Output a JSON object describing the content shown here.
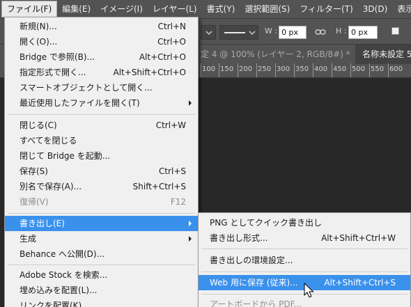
{
  "menubar": {
    "items": [
      {
        "label": "ファイル(F)",
        "active": true
      },
      {
        "label": "編集(E)"
      },
      {
        "label": "イメージ(I)"
      },
      {
        "label": "レイヤー(L)"
      },
      {
        "label": "書式(Y)"
      },
      {
        "label": "選択範囲(S)"
      },
      {
        "label": "フィルター(T)"
      },
      {
        "label": "3D(D)"
      },
      {
        "label": "表示(V"
      }
    ]
  },
  "options_bar": {
    "w_label": "W :",
    "w_value": "0 px",
    "link_icon": "link-icon",
    "h_label": "H :",
    "h_value": "0 px"
  },
  "tabs": {
    "left": "定 4 @ 100% (レイヤー 2, RGB/8#) *",
    "close": "×",
    "right": "名称未設定 5"
  },
  "ruler": {
    "labels": [
      "100",
      "150",
      "200",
      "250",
      "300",
      "350",
      "400",
      "450",
      "500",
      "550",
      "600"
    ]
  },
  "file_menu": {
    "items": [
      {
        "label": "新規(N)...",
        "shortcut": "Ctrl+N"
      },
      {
        "label": "開く(O)...",
        "shortcut": "Ctrl+O"
      },
      {
        "label": "Bridge で参照(B)...",
        "shortcut": "Alt+Ctrl+O"
      },
      {
        "label": "指定形式で開く...",
        "shortcut": "Alt+Shift+Ctrl+O"
      },
      {
        "label": "スマートオブジェクトとして開く...",
        "shortcut": ""
      },
      {
        "label": "最近使用したファイルを開く(T)",
        "shortcut": "",
        "submenu": true
      },
      {
        "label": "閉じる(C)",
        "shortcut": "Ctrl+W"
      },
      {
        "label": "すべてを閉じる",
        "shortcut": ""
      },
      {
        "label": "閉じて Bridge を起動...",
        "shortcut": ""
      },
      {
        "label": "保存(S)",
        "shortcut": "Ctrl+S"
      },
      {
        "label": "別名で保存(A)...",
        "shortcut": "Shift+Ctrl+S"
      },
      {
        "label": "復帰(V)",
        "shortcut": "F12",
        "disabled": true
      },
      {
        "label": "書き出し(E)",
        "shortcut": "",
        "submenu": true,
        "highlighted": true
      },
      {
        "label": "生成",
        "shortcut": "",
        "submenu": true
      },
      {
        "label": "Behance へ公開(D)...",
        "shortcut": ""
      },
      {
        "label": "Adobe Stock を検索...",
        "shortcut": ""
      },
      {
        "label": "埋め込みを配置(L)...",
        "shortcut": ""
      },
      {
        "label": "リンクを配置(K)...",
        "shortcut": ""
      }
    ]
  },
  "export_submenu": {
    "items": [
      {
        "label": "PNG としてクイック書き出し",
        "shortcut": ""
      },
      {
        "label": "書き出し形式...",
        "shortcut": "Alt+Shift+Ctrl+W"
      },
      {
        "label": "書き出しの環境設定...",
        "shortcut": ""
      },
      {
        "label": "Web 用に保存 (従来)...",
        "shortcut": "Alt+Shift+Ctrl+S",
        "highlighted": true
      },
      {
        "label": "アートボードから PDF...",
        "shortcut": "",
        "disabled": true
      }
    ]
  },
  "colors": {
    "menu_bg": "#f0f0f0",
    "highlight": "#3a91ec",
    "app_bg": "#535353",
    "canvas": "#282828"
  }
}
